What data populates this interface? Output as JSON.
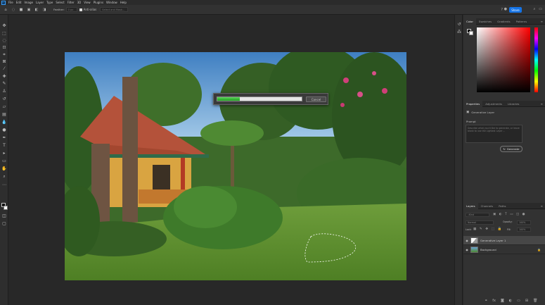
{
  "colors": {
    "accent": "#1473e6",
    "progress": "#2dbb2d"
  },
  "menu": {
    "logo": "Ps",
    "items": [
      "File",
      "Edit",
      "Image",
      "Layer",
      "Type",
      "Select",
      "Filter",
      "3D",
      "View",
      "Plugins",
      "Window",
      "Help"
    ]
  },
  "options": {
    "feather_label": "Feather:",
    "feather_value": "0 px",
    "antialias_label": "Anti-alias",
    "select_mask_label": "Select and Mask...",
    "share_label": "Share"
  },
  "progress": {
    "value": 0.27,
    "cancel_label": "Cancel"
  },
  "panels": {
    "color_tabs": [
      "Color",
      "Swatches",
      "Gradients",
      "Patterns"
    ],
    "props_tabs": [
      "Properties",
      "Adjustments",
      "Libraries"
    ],
    "props_layer_type": "Generative Layer",
    "prompt_label": "Prompt",
    "prompt_placeholder": "Describe what you'd like to generate, or leave blank to use the Lightest Layer…",
    "generate_label": "Generate",
    "layers_tabs": [
      "Layers",
      "Channels",
      "Paths"
    ],
    "kind_label": "Kind",
    "blend_mode": "Normal",
    "opacity_label": "Opacity:",
    "opacity_value": "100%",
    "lock_label": "Lock:",
    "fill_label": "Fill:",
    "fill_value": "100%",
    "layers": [
      {
        "name": "Generative Layer 1",
        "selected": true
      },
      {
        "name": "Background",
        "selected": false
      }
    ]
  }
}
